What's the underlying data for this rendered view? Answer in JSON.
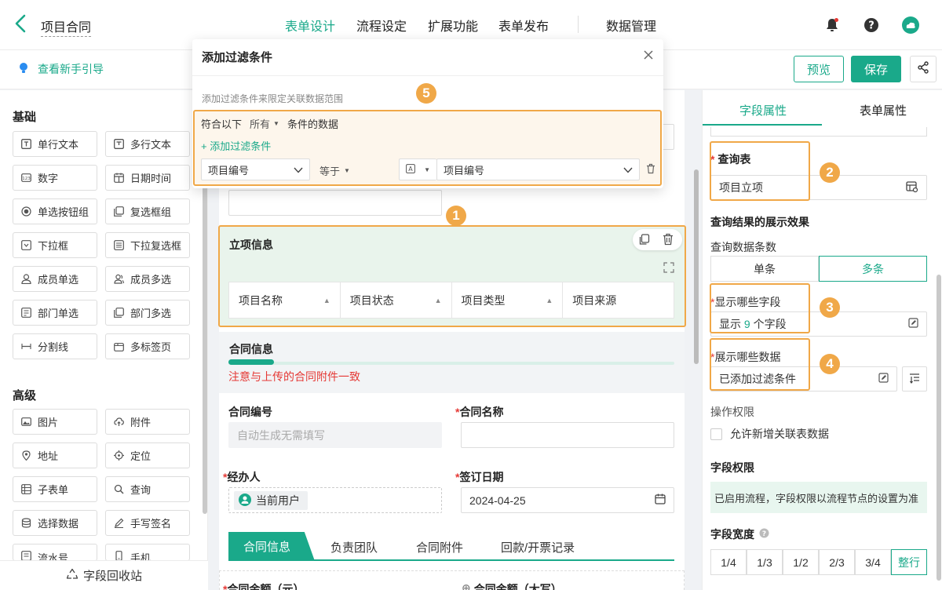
{
  "header": {
    "title": "项目合同",
    "tabs": [
      "表单设计",
      "流程设定",
      "扩展功能",
      "表单发布",
      "数据管理"
    ],
    "active_tab": "表单设计",
    "accent": "#1aa98a"
  },
  "toolbar": {
    "guide": "查看新手引导",
    "preview": "预览",
    "save": "保存"
  },
  "components": {
    "basic_title": "基础",
    "basic": [
      "单行文本",
      "多行文本",
      "数字",
      "日期时间",
      "单选按钮组",
      "复选框组",
      "下拉框",
      "下拉复选框",
      "成员单选",
      "成员多选",
      "部门单选",
      "部门多选",
      "分割线",
      "多标签页"
    ],
    "advanced_title": "高级",
    "advanced": [
      "图片",
      "附件",
      "地址",
      "定位",
      "子表单",
      "查询",
      "选择数据",
      "手写签名",
      "流水号",
      "手机"
    ],
    "recycle": "字段回收站"
  },
  "form": {
    "section1": "立项信息",
    "columns": [
      "项目名称",
      "项目状态",
      "项目类型",
      "项目来源"
    ],
    "section2": "合同信息",
    "warning": "注意与上传的合同附件一致",
    "contract_no_label": "合同编号",
    "contract_no_placeholder": "自动生成无需填写",
    "contract_name_label": "合同名称",
    "handler_label": "经办人",
    "handler_value": "当前用户",
    "sign_date_label": "签订日期",
    "sign_date_value": "2024-04-25",
    "tabs": [
      "合同信息",
      "负责团队",
      "合同附件",
      "回款/开票记录"
    ],
    "bottom_left": "合同金额（元）",
    "bottom_right": "合同金额（大写）"
  },
  "right": {
    "tabs": [
      "字段属性",
      "表单属性"
    ],
    "query_table_label": "查询表",
    "query_table_value": "项目立项",
    "display_title": "查询结果的展示效果",
    "count_label": "查询数据条数",
    "count_options": [
      "单条",
      "多条"
    ],
    "fields_label": "显示哪些字段",
    "fields_prefix": "显示",
    "fields_count": "9",
    "fields_suffix": "个字段",
    "data_label": "展示哪些数据",
    "data_value": "已添加过滤条件",
    "perm_label": "操作权限",
    "perm_check": "允许新增关联表数据",
    "field_perm_title": "字段权限",
    "field_perm_note": "已启用流程，字段权限以流程节点的设置为准",
    "width_title": "字段宽度",
    "width_options": [
      "1/4",
      "1/3",
      "1/2",
      "2/3",
      "3/4",
      "整行"
    ]
  },
  "dialog": {
    "title": "添加过滤条件",
    "desc": "添加过滤条件来限定关联数据范围",
    "match_prefix": "符合以下",
    "match_mode": "所有",
    "match_suffix": "条件的数据",
    "add": "+ 添加过滤条件",
    "field": "项目编号",
    "operator": "等于",
    "value_field": "项目编号"
  },
  "badges": [
    "1",
    "2",
    "3",
    "4",
    "5"
  ],
  "highlight_color": "#f0a848"
}
